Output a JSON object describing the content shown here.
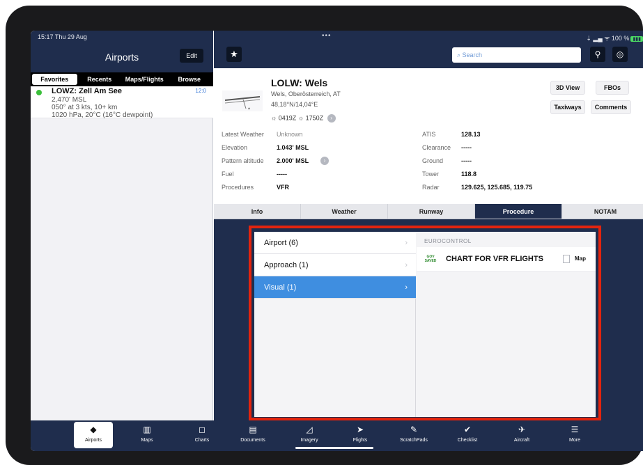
{
  "status": {
    "time": "15:17  Thu 29 Aug",
    "dots": "•••",
    "right": "⇣ ▂▄ ᯤ 100 %",
    "battery": "▮▮▮"
  },
  "sidebar": {
    "title": "Airports",
    "edit": "Edit",
    "segments": [
      "Favorites",
      "Recents",
      "Maps/Flights",
      "Browse"
    ],
    "favorite": {
      "name": "LOWZ: Zell Am See",
      "time": "12:0",
      "elevation": "2,470' MSL",
      "wind": "050° at 3 kts, 10+ km",
      "pressure": "1020 hPa, 20°C (16°C dewpoint)"
    }
  },
  "search": {
    "placeholder": "Search"
  },
  "airport": {
    "title": "LOLW: Wels",
    "location": "Wels, Oberösterreich, AT",
    "coords": "48,18°N/14,04°E",
    "sunrise": "0419Z",
    "sunset": "1750Z",
    "buttons": {
      "view3d": "3D View",
      "fbos": "FBOs",
      "taxiways": "Taxiways",
      "comments": "Comments"
    },
    "left": [
      {
        "label": "Latest Weather",
        "value": "Unknown"
      },
      {
        "label": "Elevation",
        "value": "1.043' MSL"
      },
      {
        "label": "Pattern altitude",
        "value": "2.000' MSL"
      },
      {
        "label": "Fuel",
        "value": "-----"
      },
      {
        "label": "Procedures",
        "value": "VFR"
      }
    ],
    "right": [
      {
        "label": "ATIS",
        "value": "128.13"
      },
      {
        "label": "Clearance",
        "value": "-----"
      },
      {
        "label": "Ground",
        "value": "-----"
      },
      {
        "label": "Tower",
        "value": "118.8"
      },
      {
        "label": "Radar",
        "value": "129.625, 125.685, 119.75"
      }
    ]
  },
  "tabs": [
    "Info",
    "Weather",
    "Runway",
    "Procedure",
    "NOTAM"
  ],
  "procedures": {
    "items": [
      {
        "label": "Airport (6)"
      },
      {
        "label": "Approach (1)"
      },
      {
        "label": "Visual (1)"
      }
    ],
    "section": "EUROCONTROL",
    "gov_badge": "GOV SAVED",
    "chart": "CHART FOR VFR FLIGHTS",
    "map": "Map"
  },
  "tabbar": [
    {
      "label": "Airports",
      "icon": "compass-icon"
    },
    {
      "label": "Maps",
      "icon": "book-map-icon"
    },
    {
      "label": "Charts",
      "icon": "chart-frame-icon"
    },
    {
      "label": "Documents",
      "icon": "documents-icon"
    },
    {
      "label": "Imagery",
      "icon": "imagery-icon"
    },
    {
      "label": "Flights",
      "icon": "flights-icon"
    },
    {
      "label": "ScratchPads",
      "icon": "pencil-icon"
    },
    {
      "label": "Checklist",
      "icon": "checkmark-icon"
    },
    {
      "label": "Aircraft",
      "icon": "airplane-icon"
    },
    {
      "label": "More",
      "icon": "menu-icon"
    }
  ],
  "colors": {
    "navy": "#1f2d4d",
    "selected_blue": "#3f8ee0",
    "highlight_red": "#e3240e",
    "search_text": "#6f9ad6",
    "status_green": "#3bbf3b"
  }
}
